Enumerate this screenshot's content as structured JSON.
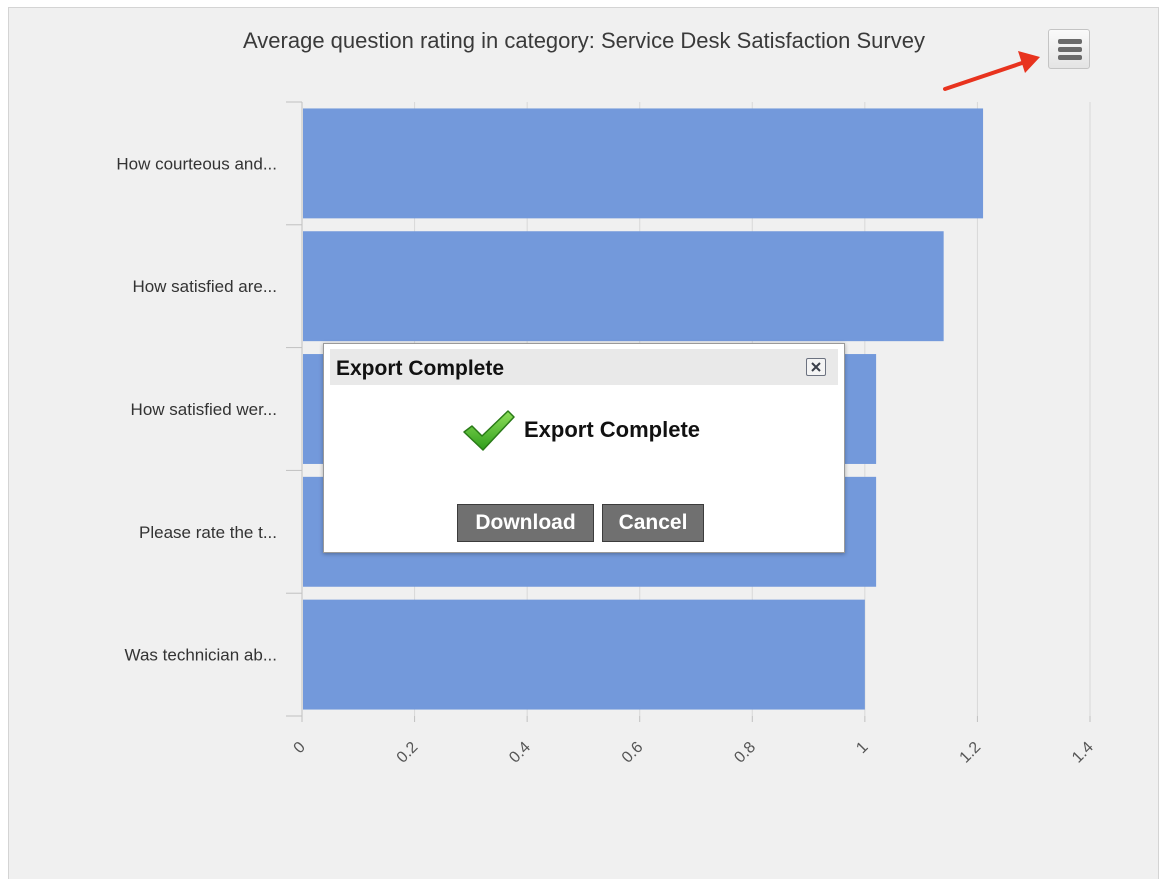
{
  "chart_data": {
    "type": "bar",
    "orientation": "horizontal",
    "title": "Average question rating in category: Service Desk Satisfaction Survey",
    "categories": [
      "How courteous and...",
      "How satisfied are...",
      "How satisfied wer...",
      "Please rate the t...",
      "Was technician ab..."
    ],
    "values": [
      1.21,
      1.14,
      1.02,
      1.02,
      1.0
    ],
    "xlim": [
      0,
      1.4
    ],
    "xticks": [
      "0",
      "0.2",
      "0.4",
      "0.6",
      "0.8",
      "1",
      "1.2",
      "1.4"
    ],
    "bar_color": "#7399db",
    "grid": true,
    "legend": false
  },
  "menu_button": {
    "icon": "hamburger-menu-icon"
  },
  "annotation": {
    "color": "#e8331e"
  },
  "dialog": {
    "title": "Export Complete",
    "message": "Export Complete",
    "icon": "checkmark-icon",
    "download_label": "Download",
    "cancel_label": "Cancel"
  }
}
